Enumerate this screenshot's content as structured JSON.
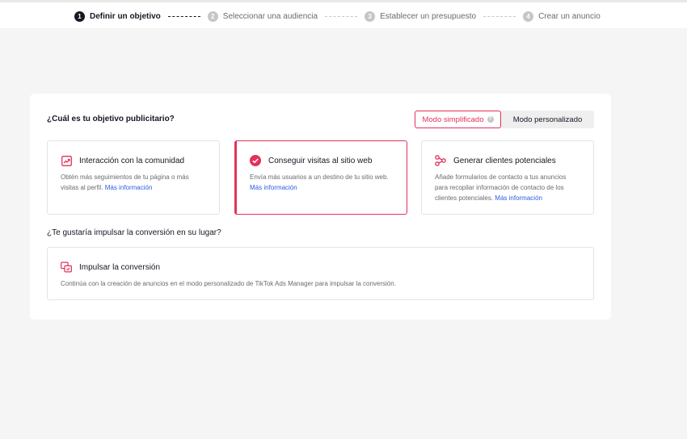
{
  "steps": [
    {
      "num": "1",
      "label": "Definir un objetivo"
    },
    {
      "num": "2",
      "label": "Seleccionar una audiencia"
    },
    {
      "num": "3",
      "label": "Establecer un presupuesto"
    },
    {
      "num": "4",
      "label": "Crear un anuncio"
    }
  ],
  "objective": {
    "question": "¿Cuál es tu objetivo publicitario?",
    "mode_simplified": "Modo simplificado",
    "mode_custom": "Modo personalizado",
    "help_glyph": "?"
  },
  "options": [
    {
      "title": "Interacción con la comunidad",
      "desc": "Obtén más seguimientos de tu página o más visitas al perfil.",
      "link": "Más información",
      "icon": "trend-up-icon"
    },
    {
      "title": "Conseguir visitas al sitio web",
      "desc": "Envía más usuarios a un destino de tu sitio web.",
      "link": "Más información",
      "icon": "check-circle-icon"
    },
    {
      "title": "Generar clientes potenciales",
      "desc": "Añade formularios de contacto a tus anuncios para recopilar información de contacto de los clientes potenciales.",
      "link": "Más información",
      "icon": "share-nodes-icon"
    }
  ],
  "conversion": {
    "question": "¿Te gustaría impulsar la conversión en su lugar?",
    "title": "Impulsar la conversión",
    "desc": "Continúa con la creación de anuncios en el modo personalizado de TikTok Ads Manager para impulsar la conversión.",
    "icon": "conversion-icon"
  },
  "colors": {
    "accent": "#e2325b",
    "link": "#2b5de0",
    "text": "#161823",
    "muted": "#6a6b70"
  }
}
